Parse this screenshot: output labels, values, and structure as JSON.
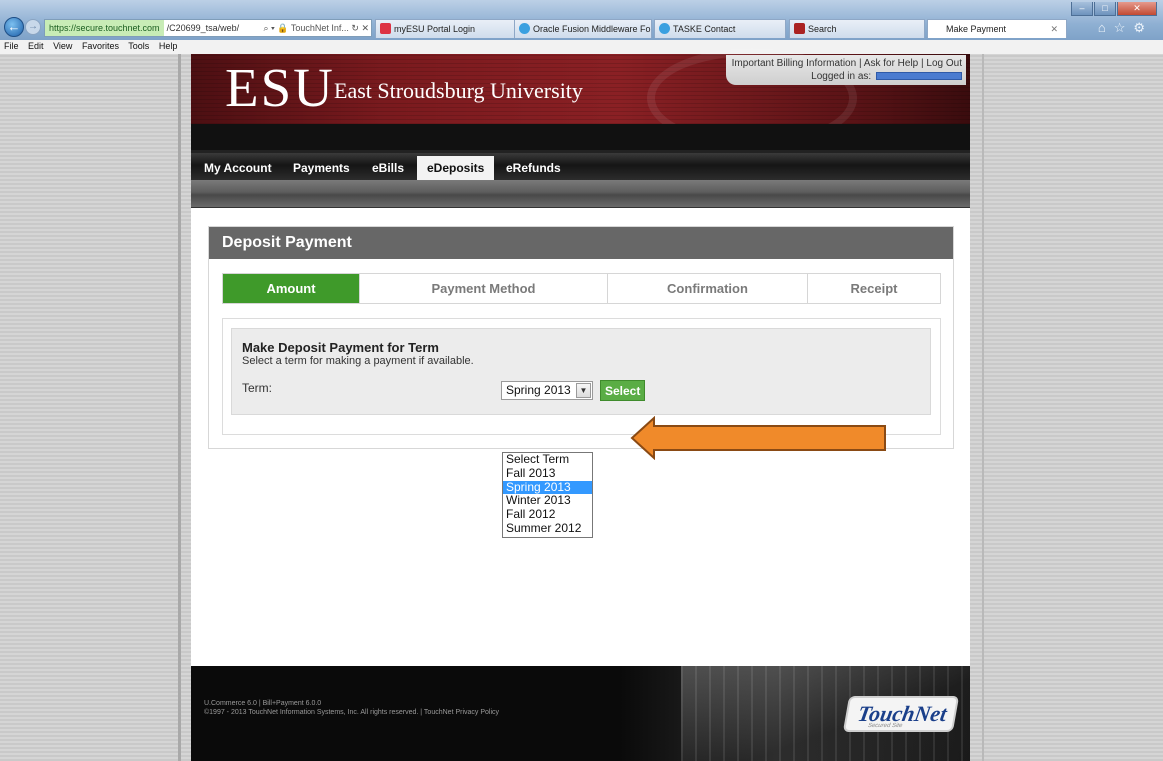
{
  "browser": {
    "address": {
      "secure_host": "https://secure.touchnet.com",
      "path": "/C20699_tsa/web/",
      "site_label": "TouchNet Inf..."
    },
    "tabs": [
      {
        "label": "myESU Portal Login"
      },
      {
        "label": "Oracle Fusion Middleware For..."
      },
      {
        "label": "TASKE Contact"
      },
      {
        "label": "Search"
      },
      {
        "label": "Make Payment"
      }
    ],
    "menu": [
      "File",
      "Edit",
      "View",
      "Favorites",
      "Tools",
      "Help"
    ]
  },
  "header": {
    "logo": "ESU",
    "university_name": "East Stroudsburg University",
    "top_links": [
      "Important Billing Information",
      "Ask for Help",
      "Log Out"
    ],
    "logged_in_label": "Logged in as:"
  },
  "nav": {
    "items": [
      "My Account",
      "Payments",
      "eBills",
      "eDeposits",
      "eRefunds"
    ],
    "active": "eDeposits"
  },
  "panel": {
    "title": "Deposit Payment",
    "steps": [
      "Amount",
      "Payment Method",
      "Confirmation",
      "Receipt"
    ],
    "active_step": "Amount"
  },
  "term_form": {
    "heading": "Make Deposit Payment for Term",
    "description": "Select a term for making a payment if available.",
    "label": "Term:",
    "selected": "Spring 2013",
    "options": [
      "Select Term",
      "Fall 2013",
      "Spring 2013",
      "Winter 2013",
      "Fall 2012",
      "Summer 2012"
    ],
    "button": "Select"
  },
  "footer": {
    "line1": "U.Commerce 6.0 | Bill+Payment 6.0.0",
    "line2": "©1997 - 2013 TouchNet Information Systems, Inc. All rights reserved. | TouchNet Privacy Policy",
    "logo_text": "TouchNet",
    "logo_sub": "Secured Site"
  },
  "colors": {
    "accent_green": "#3f9a2a",
    "header_maroon": "#7a1a1e",
    "annotation_arrow": "#f08a2a"
  },
  "icons": [
    "back-arrow-icon",
    "forward-arrow-icon",
    "search-icon",
    "lock-icon",
    "refresh-icon",
    "close-icon",
    "home-icon",
    "star-icon",
    "gear-icon",
    "dropdown-arrow-icon"
  ]
}
